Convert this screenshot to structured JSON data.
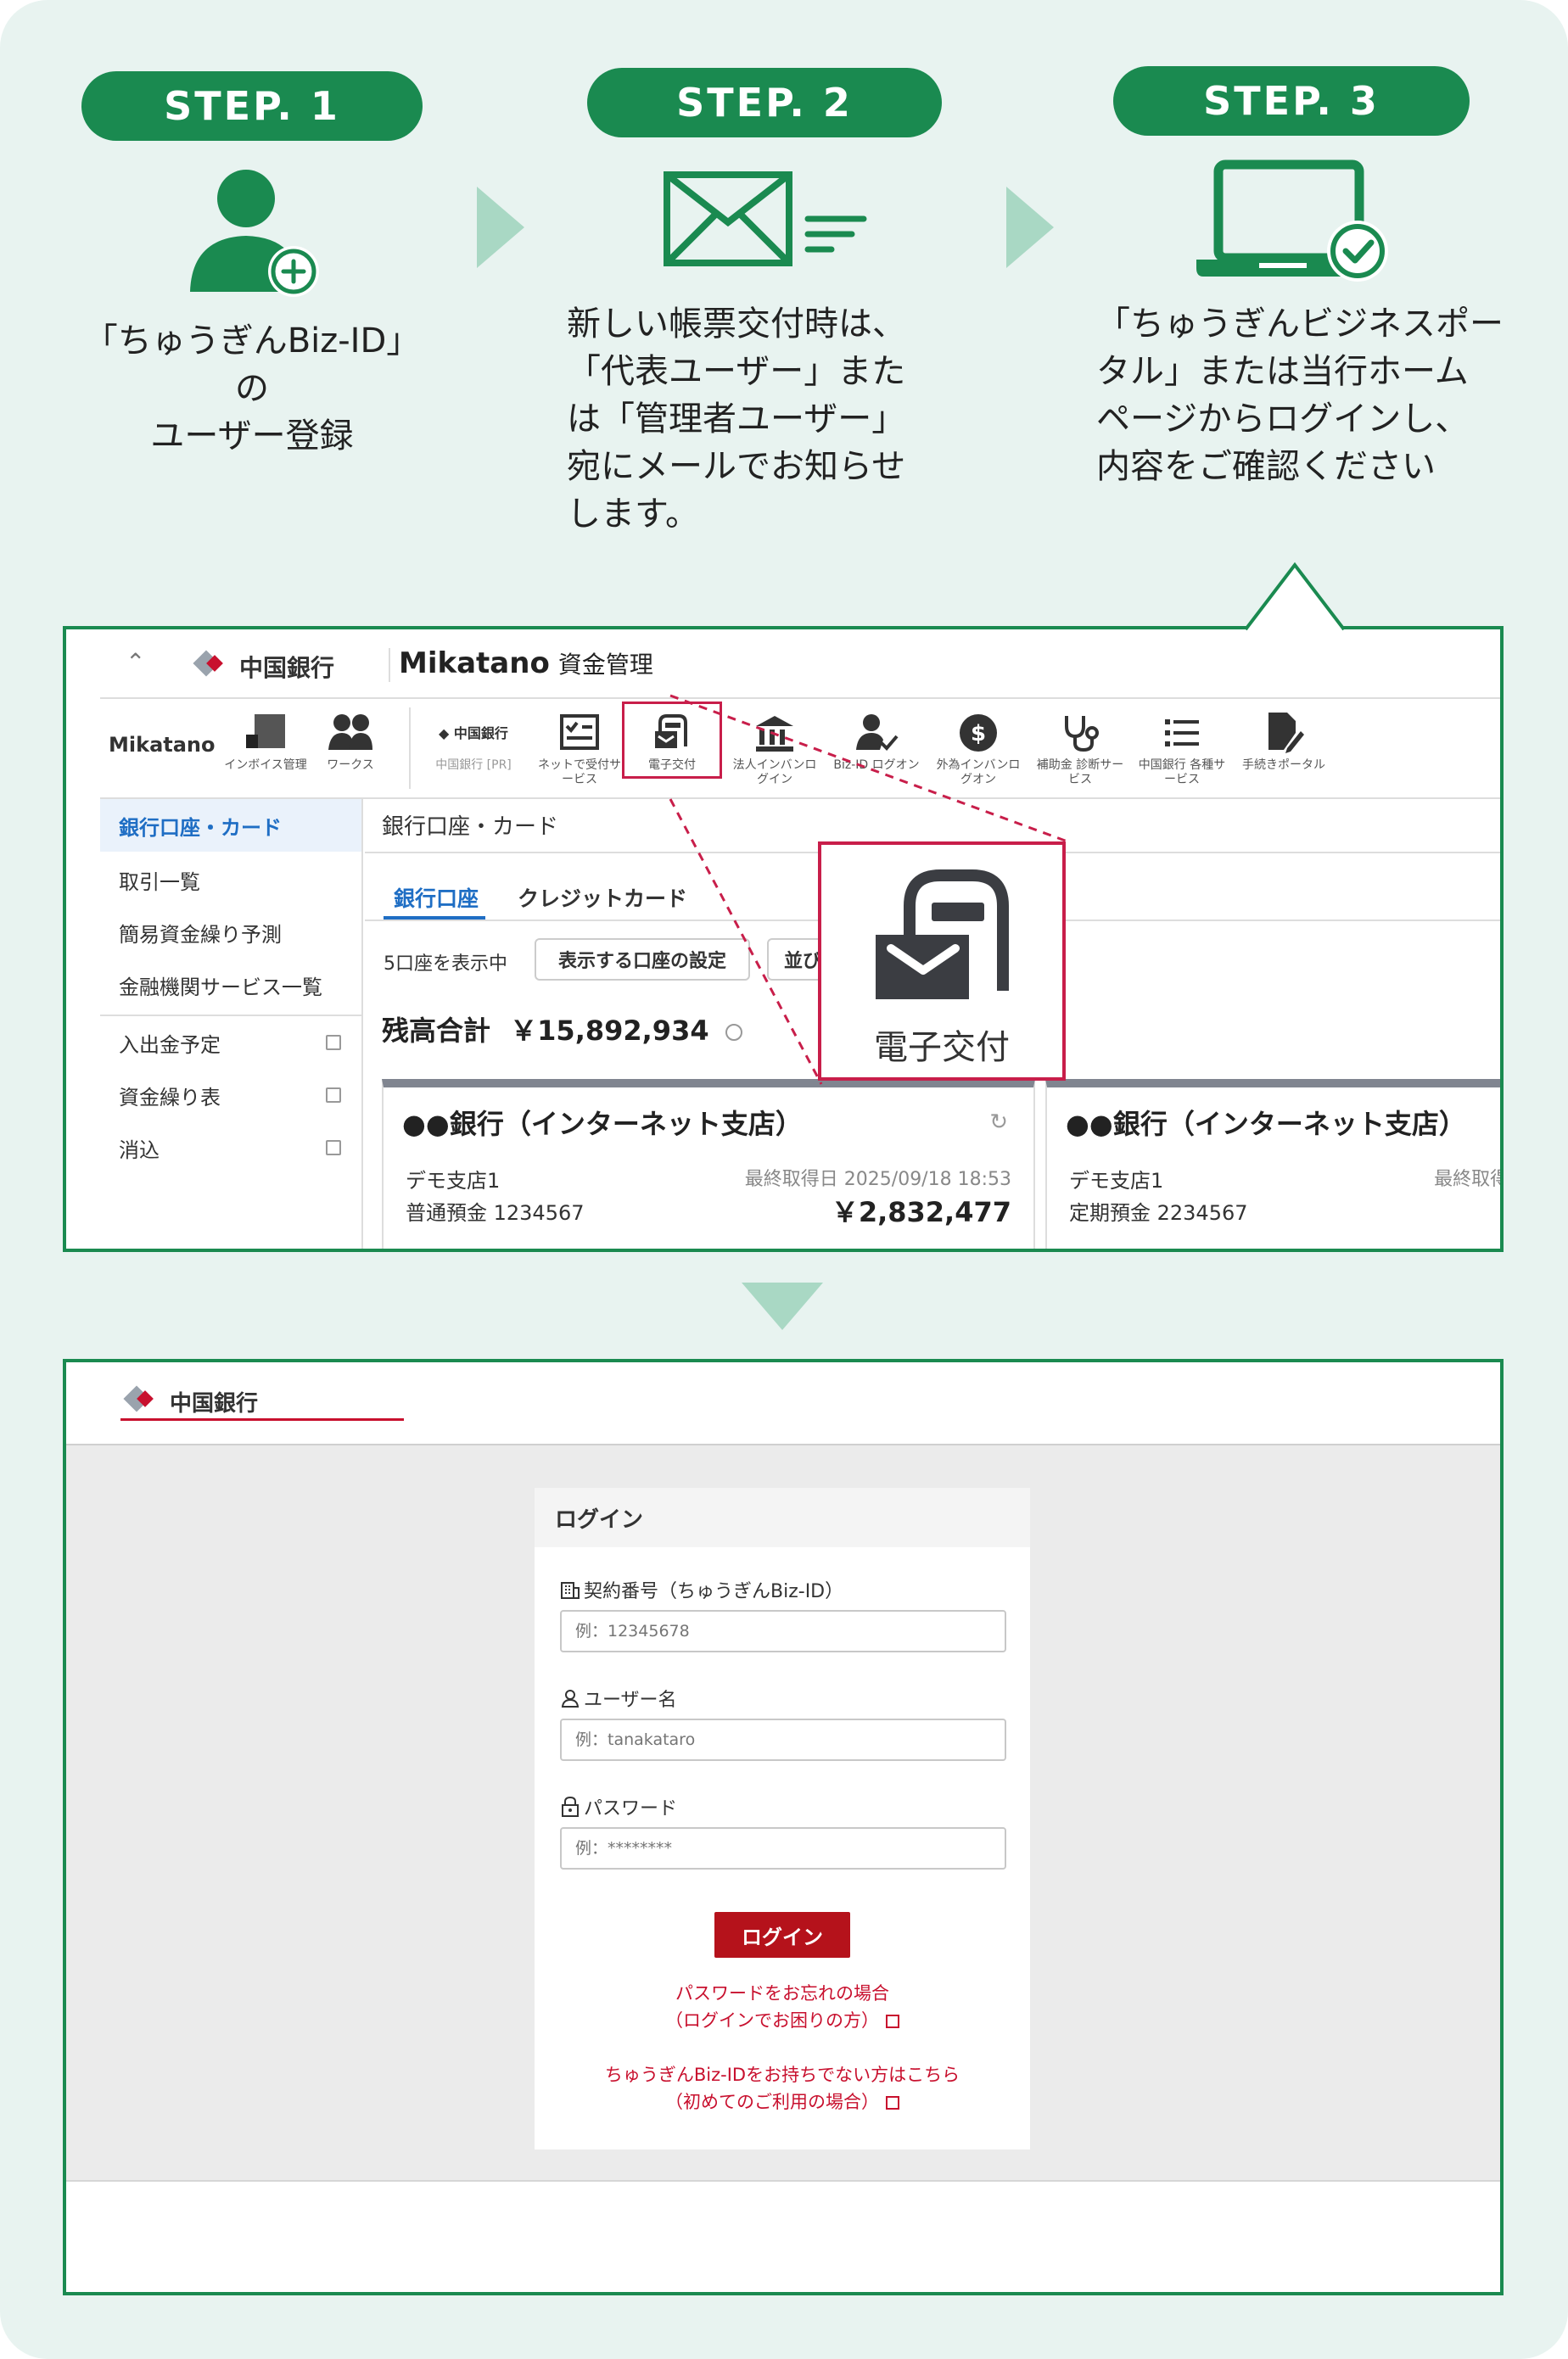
{
  "steps": [
    {
      "label": "STEP. 1",
      "text_lines": [
        "「ちゅうぎんBiz-ID」の",
        "ユーザー登録"
      ]
    },
    {
      "label": "STEP. 2",
      "text_lines": [
        "新しい帳票交付時は、",
        "「代表ユーザー」また",
        "は「管理者ユーザー」",
        "宛にメールでお知らせ",
        "します。"
      ]
    },
    {
      "label": "STEP. 3",
      "text_lines": [
        "「ちゅうぎんビジネスポー",
        "タル」または当行ホーム",
        "ページからログインし、",
        "内容をご確認ください"
      ]
    }
  ],
  "colors": {
    "brand_green": "#1a8a50",
    "arrow_green": "#a9d8c4",
    "highlight_red": "#c81e4a",
    "link_blue": "#1f6ec4",
    "login_red": "#b5121b"
  },
  "portal": {
    "bank_name": "中国銀行",
    "app_title": "Mikatano",
    "app_subtitle": "資金管理",
    "toolbar": {
      "brand": "Mikatano",
      "items": [
        {
          "label": "インボイス管理",
          "icon": "invoice-icon"
        },
        {
          "label": "ワークス",
          "icon": "users-icon"
        },
        {
          "label": "中国銀行 [PR]",
          "icon": "bank-pr-icon"
        },
        {
          "label": "ネットで受付サービス",
          "icon": "checklist-icon"
        },
        {
          "label": "電子交付",
          "icon": "e-delivery-icon"
        },
        {
          "label": "法人インバンログイン",
          "icon": "bank-building-icon"
        },
        {
          "label": "Biz-ID ログオン",
          "icon": "user-check-icon"
        },
        {
          "label": "外為インバンログオン",
          "icon": "dollar-icon"
        },
        {
          "label": "補助金 診断サービス",
          "icon": "stethoscope-icon"
        },
        {
          "label": "中国銀行 各種サービス",
          "icon": "list-icon"
        },
        {
          "label": "手続きポータル",
          "icon": "document-edit-icon"
        }
      ]
    },
    "sidebar": [
      {
        "label": "銀行口座・カード",
        "active": true,
        "external": false
      },
      {
        "label": "取引一覧",
        "active": false,
        "external": false
      },
      {
        "label": "簡易資金繰り予測",
        "active": false,
        "external": false
      },
      {
        "label": "金融機関サービス一覧",
        "active": false,
        "external": false
      },
      {
        "label": "入出金予定",
        "active": false,
        "external": true
      },
      {
        "label": "資金繰り表",
        "active": false,
        "external": true
      },
      {
        "label": "消込",
        "active": false,
        "external": true
      }
    ],
    "main": {
      "title": "銀行口座・カード",
      "tabs": [
        "銀行口座",
        "クレジットカード"
      ],
      "showing": "5口座を表示中",
      "settings_button": "表示する口座の設定",
      "sort_button": "並び",
      "balance_label": "残高合計",
      "balance_value": "￥15,892,934",
      "cards": [
        {
          "title": "●●銀行（インターネット支店）",
          "branch": "デモ支店1",
          "account": "普通預金 1234567",
          "updated": "最終取得日 2025/09/18 18:53",
          "amount": "￥2,832,477"
        },
        {
          "title": "●●銀行（インターネット支店）",
          "branch": "デモ支店1",
          "account": "定期預金 2234567",
          "updated": "最終取得E",
          "amount": ""
        }
      ]
    },
    "zoom": {
      "label": "電子交付",
      "icon": "e-delivery-icon"
    }
  },
  "login": {
    "bank_name": "中国銀行",
    "card_title": "ログイン",
    "fields": [
      {
        "label": "契約番号（ちゅうぎんBiz-ID）",
        "icon": "building-icon",
        "placeholder": "例：12345678"
      },
      {
        "label": "ユーザー名",
        "icon": "user-icon",
        "placeholder": "例：tanakataro"
      },
      {
        "label": "パスワード",
        "icon": "lock-icon",
        "placeholder": "例：********"
      }
    ],
    "submit_label": "ログイン",
    "links": [
      {
        "lines": [
          "パスワードをお忘れの場合",
          "（ログインでお困りの方）"
        ]
      },
      {
        "lines": [
          "ちゅうぎんBiz-IDをお持ちでない方はこちら",
          "（初めてのご利用の場合）"
        ]
      }
    ]
  }
}
